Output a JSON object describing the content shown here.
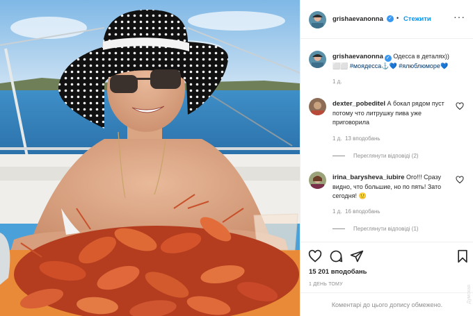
{
  "header": {
    "username": "grishaevanonna",
    "verified_icon": "verified-badge-icon",
    "follow_label": "Стежити",
    "more_icon": "more-options-icon"
  },
  "caption": {
    "username": "grishaevanonna",
    "text": " Одесса в деталях))",
    "line2_prefix": "⬜⬜ ",
    "hashtag1": "#моядесса",
    "emoji1": "⚓💙 ",
    "hashtag2": "#ялюблюморе",
    "emoji2": "💙",
    "time": "1 д."
  },
  "comments": [
    {
      "username": "dexter_pobeditel",
      "text": "А бокал рядом пуст потому что литрушку пива уже приговорила",
      "time": "1 д.",
      "likes": "13 вподобань",
      "replies": "Переглянути відповіді (2)"
    },
    {
      "username": "irina_barysheva_iubire",
      "text": "Ого!!! Сразу видно, что большие, но по пять! Зато сегодня! 🙂",
      "time": "1 д.",
      "likes": "16 вподобань",
      "replies": "Переглянути відповіді (1)"
    }
  ],
  "actions": {
    "icons": [
      "heart-icon",
      "comment-icon",
      "share-icon",
      "bookmark-icon"
    ],
    "likes_count": "15 201 вподобань",
    "date": "1 ДЕНЬ ТОМУ",
    "comments_restricted": "Коментарі до цього допису обмежено."
  },
  "watermark": "Думская",
  "colors": {
    "accent": "#0095f6",
    "verified": "#3897f0",
    "hashtag": "#00376b",
    "muted": "#8e8e8e",
    "border": "#efefef"
  }
}
